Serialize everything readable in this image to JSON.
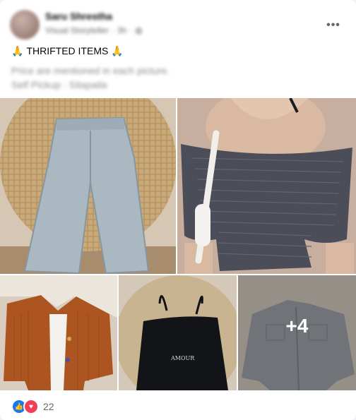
{
  "post": {
    "author_name": "Saru Shrestha",
    "meta_badge": "Visual Storyteller",
    "meta_time": "3h",
    "caption_title": "THRIFTED ITEMS",
    "caption_line2": "Price are mentioned in each picture.",
    "caption_line3": "Self Pickup : Sitapaila"
  },
  "gallery": {
    "more_overlay": "+4"
  },
  "reactions": {
    "count": "22"
  },
  "colors": {
    "like": "#1877f2",
    "love": "#f33e58"
  },
  "icons": [
    "more-options-icon",
    "folded-hands-icon",
    "globe-icon",
    "like-reaction-icon",
    "love-reaction-icon"
  ]
}
